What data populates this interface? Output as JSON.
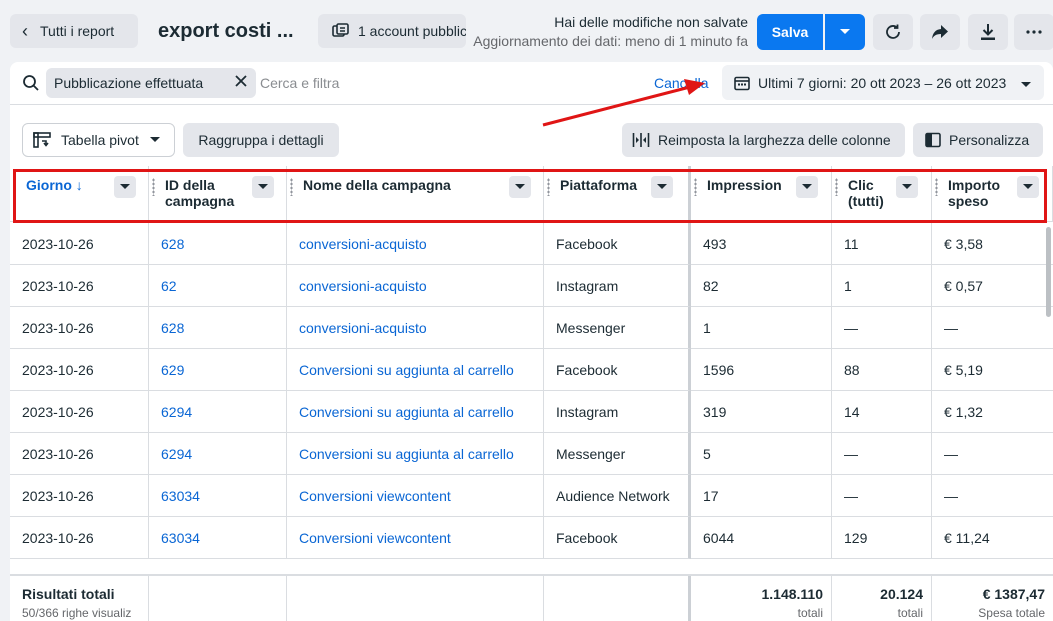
{
  "topbar": {
    "back_label": "Tutti i report",
    "report_title": "export costi ...",
    "account_label": "1 account pubblic",
    "unsaved_msg": "Hai delle modifiche non salvate",
    "update_msg": "Aggiornamento dei dati: meno di 1 minuto fa",
    "save_label": "Salva"
  },
  "filter": {
    "chip_label": "Pubblicazione effettuata",
    "placeholder": "Cerca e filtra",
    "cancel_label": "Cancella",
    "date_range": "Ultimi 7 giorni: 20 ott 2023 – 26 ott 2023"
  },
  "toolbar": {
    "pivot_label": "Tabella pivot",
    "group_label": "Raggruppa i dettagli",
    "reset_label": "Reimposta la larghezza delle colonne",
    "customize_label": "Personalizza"
  },
  "columns": {
    "day": "Giorno ↓",
    "campaign_id_1": "ID della",
    "campaign_id_2": "campagna",
    "campaign_name": "Nome della campagna",
    "platform": "Piattaforma",
    "impressions": "Impression",
    "clicks_1": "Clic",
    "clicks_2": "(tutti)",
    "spend_1": "Importo",
    "spend_2": "speso"
  },
  "rows": [
    {
      "day": "2023-10-26",
      "id": "628",
      "name": "conversioni-acquisto",
      "platform": "Facebook",
      "impr": "493",
      "clicks": "11",
      "spend": "€ 3,58"
    },
    {
      "day": "2023-10-26",
      "id": "62",
      "name": "conversioni-acquisto",
      "platform": "Instagram",
      "impr": "82",
      "clicks": "1",
      "spend": "€ 0,57"
    },
    {
      "day": "2023-10-26",
      "id": "628",
      "name": "conversioni-acquisto",
      "platform": "Messenger",
      "impr": "1",
      "clicks": "—",
      "spend": "—"
    },
    {
      "day": "2023-10-26",
      "id": "629",
      "name": "Conversioni su aggiunta al carrello",
      "platform": "Facebook",
      "impr": "1596",
      "clicks": "88",
      "spend": "€ 5,19"
    },
    {
      "day": "2023-10-26",
      "id": "6294",
      "name": "Conversioni su aggiunta al carrello",
      "platform": "Instagram",
      "impr": "319",
      "clicks": "14",
      "spend": "€ 1,32"
    },
    {
      "day": "2023-10-26",
      "id": "6294",
      "name": "Conversioni su aggiunta al carrello",
      "platform": "Messenger",
      "impr": "5",
      "clicks": "—",
      "spend": "—"
    },
    {
      "day": "2023-10-26",
      "id": "63034",
      "name": "Conversioni viewcontent",
      "platform": "Audience Network",
      "impr": "17",
      "clicks": "—",
      "spend": "—"
    },
    {
      "day": "2023-10-26",
      "id": "63034",
      "name": "Conversioni viewcontent",
      "platform": "Facebook",
      "impr": "6044",
      "clicks": "129",
      "spend": "€ 11,24"
    }
  ],
  "totals": {
    "title": "Risultati totali",
    "subtitle": "50/366 righe visualiz",
    "impressions": "1.148.110",
    "impressions_sub": "totali",
    "clicks": "20.124",
    "clicks_sub": "totali",
    "spend": "€ 1387,47",
    "spend_sub": "Spesa totale"
  }
}
